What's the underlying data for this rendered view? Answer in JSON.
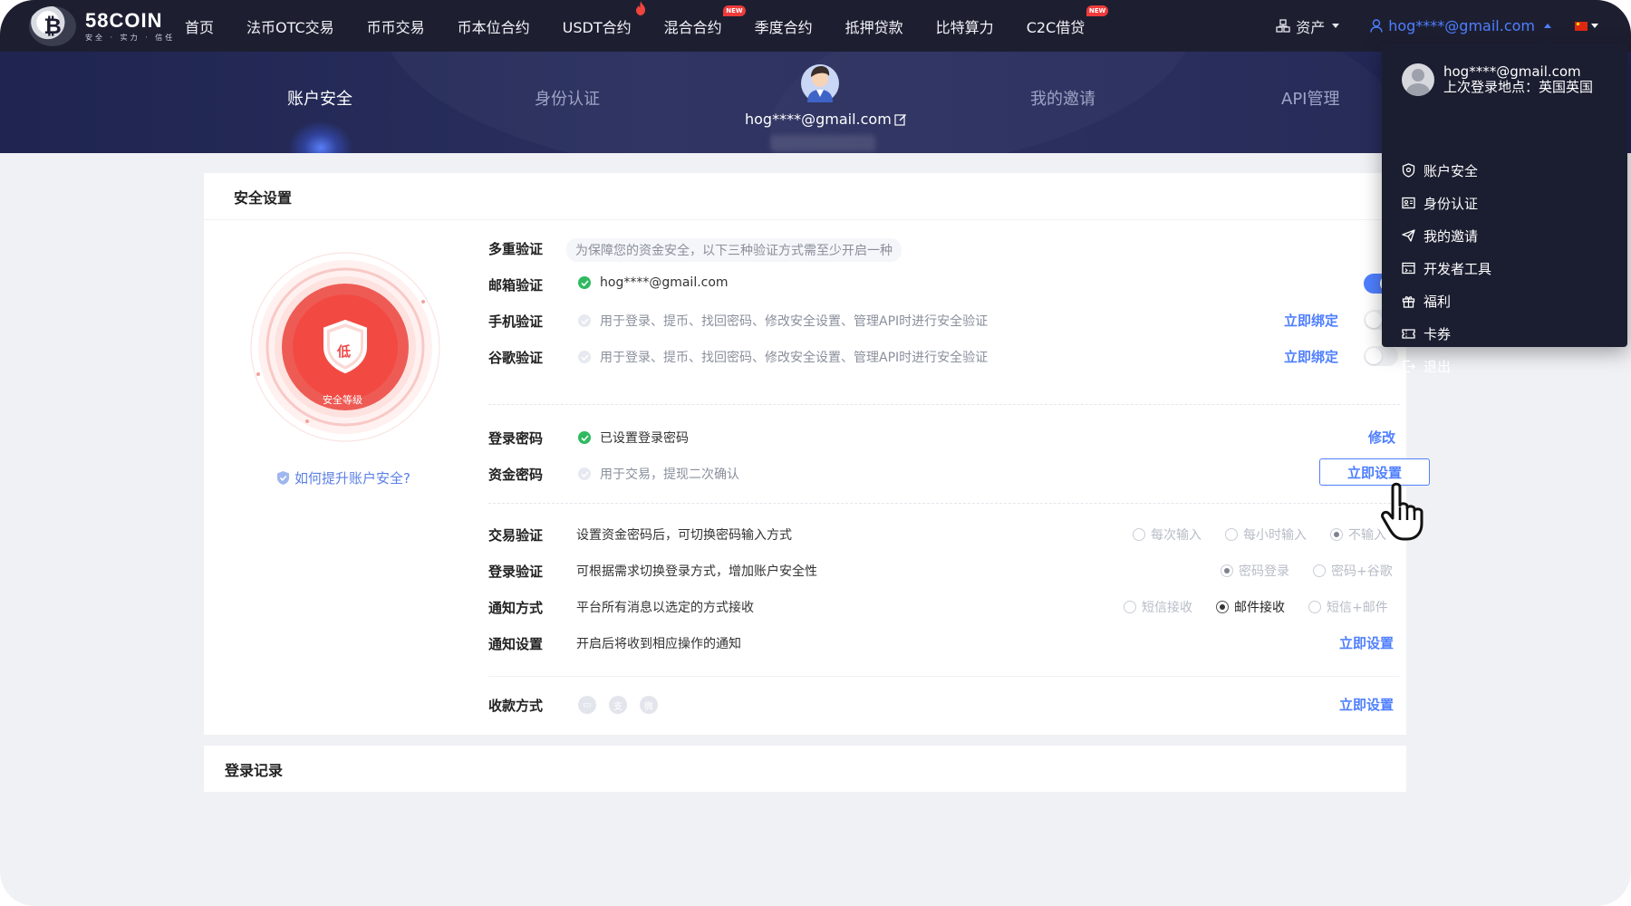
{
  "nav": {
    "logo_name": "58COIN",
    "logo_slogan": "安全 · 实力 · 信任",
    "items": [
      {
        "label": "首页"
      },
      {
        "label": "法币OTC交易"
      },
      {
        "label": "币币交易"
      },
      {
        "label": "币本位合约"
      },
      {
        "label": "USDT合约",
        "marker": "fire-icon"
      },
      {
        "label": "混合合约",
        "badge": "NEW"
      },
      {
        "label": "季度合约"
      },
      {
        "label": "抵押贷款"
      },
      {
        "label": "比特算力"
      },
      {
        "label": "C2C借贷",
        "badge": "NEW"
      }
    ],
    "assets_label": "资产",
    "user_email": "hog****@gmail.com"
  },
  "header_tabs": {
    "security": "账户安全",
    "identity": "身份认证",
    "center_email": "hog****@gmail.com",
    "invite": "我的邀请",
    "api": "API管理"
  },
  "security_card": {
    "title": "安全设置",
    "level_char": "低",
    "level_caption": "安全等级",
    "improve_link": "如何提升账户安全?",
    "multi_label": "多重验证",
    "multi_hint": "为保障您的资金安全，以下三种验证方式需至少开启一种",
    "email_label": "邮箱验证",
    "email_value": "hog****@gmail.com",
    "email_enabled": true,
    "phone_label": "手机验证",
    "phone_desc": "用于登录、提币、找回密码、修改安全设置、管理API时进行安全验证",
    "phone_action": "立即绑定",
    "phone_enabled": false,
    "google_label": "谷歌验证",
    "google_desc": "用于登录、提币、找回密码、修改安全设置、管理API时进行安全验证",
    "google_action": "立即绑定",
    "google_enabled": false,
    "login_pwd_label": "登录密码",
    "login_pwd_desc": "已设置登录密码",
    "login_pwd_action": "修改",
    "fund_pwd_label": "资金密码",
    "fund_pwd_desc": "用于交易，提现二次确认",
    "fund_pwd_action": "立即设置",
    "trade_verify_label": "交易验证",
    "trade_verify_desc": "设置资金密码后，可切换密码输入方式",
    "trade_verify_options": [
      "每次输入",
      "每小时输入",
      "不输入"
    ],
    "trade_verify_selected": "不输入",
    "login_verify_label": "登录验证",
    "login_verify_desc": "可根据需求切换登录方式，增加账户安全性",
    "login_verify_options": [
      "密码登录",
      "密码+谷歌"
    ],
    "login_verify_selected": "密码登录",
    "notify_method_label": "通知方式",
    "notify_method_desc": "平台所有消息以选定的方式接收",
    "notify_method_options": [
      "短信接收",
      "邮件接收",
      "短信+邮件"
    ],
    "notify_method_selected": "邮件接收",
    "notify_setting_label": "通知设置",
    "notify_setting_desc": "开启后将收到相应操作的通知",
    "notify_setting_action": "立即设置",
    "payment_label": "收款方式",
    "payment_icons": [
      "bank-card-icon",
      "alipay-icon",
      "wechat-pay-icon"
    ],
    "payment_action": "立即设置"
  },
  "login_record_card": {
    "title": "登录记录"
  },
  "dropdown": {
    "email": "hog****@gmail.com",
    "last_login": "上次登录地点：英国英国",
    "items": [
      {
        "label": "账户安全",
        "icon": "shield-icon"
      },
      {
        "label": "身份认证",
        "icon": "id-card-icon"
      },
      {
        "label": "我的邀请",
        "icon": "send-icon"
      },
      {
        "label": "开发者工具",
        "icon": "code-window-icon"
      },
      {
        "label": "福利",
        "icon": "gift-icon"
      },
      {
        "label": "卡券",
        "icon": "ticket-icon"
      },
      {
        "label": "退出",
        "icon": "logout-icon"
      }
    ]
  },
  "colors": {
    "nav_bg": "#1d1f31",
    "accent_blue": "#4f7fff",
    "danger_red": "#ef4a4a",
    "success_green": "#2fba5f",
    "dropdown_bg": "#1b1e30"
  }
}
